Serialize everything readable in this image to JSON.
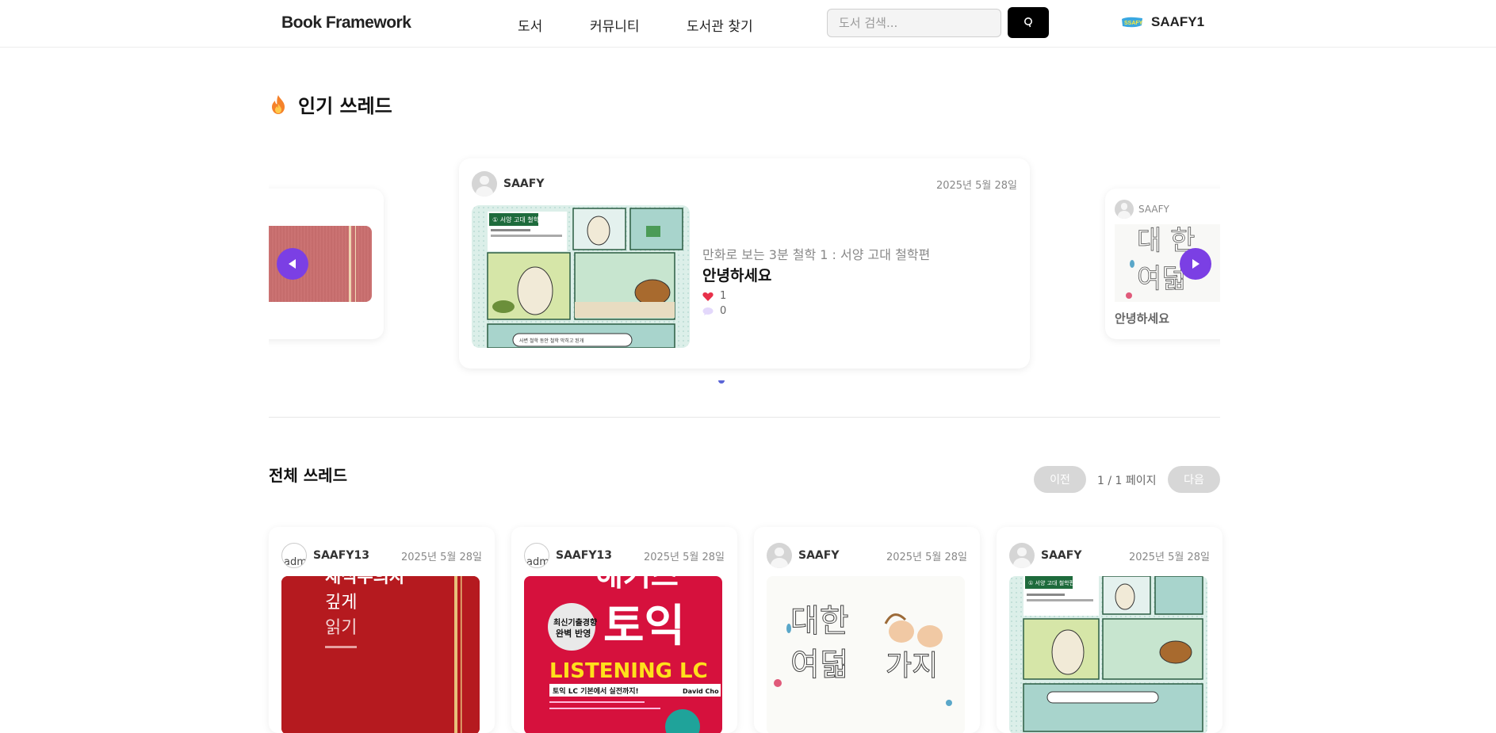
{
  "header": {
    "logo": "Book Framework",
    "nav": [
      "도서",
      "커뮤니티",
      "도서관 찾기"
    ],
    "search_placeholder": "도서 검색...",
    "user_name": "SAAFY1",
    "user_logo_icon": "ssafy-logo-icon"
  },
  "popular": {
    "title": "인기 쓰레드",
    "main_card": {
      "author": "SAAFY",
      "date": "2025년 5월 28일",
      "book": "만화로 보는 3분 철학 1 : 서양 고대 철학편",
      "cover_label": "① 서양 고대 철학편",
      "cover_caption": "사변 철학 동안 철학 막히고 된개",
      "title": "안녕하세요",
      "likes": "1",
      "comments": "0"
    },
    "right_card": {
      "author": "SAAFY",
      "title": "안녕하세요"
    }
  },
  "all": {
    "title": "전체 쓰레드",
    "prev": "이전",
    "page_info": "1 / 1 페이지",
    "next": "다음",
    "cards": [
      {
        "author": "SAAFY13",
        "date": "2025년 5월 28일",
        "avatar_alt": "adm",
        "cover_lines": [
          "채식주의자",
          "깊게",
          "읽기"
        ]
      },
      {
        "author": "SAAFY13",
        "date": "2025년 5월 28일",
        "avatar_alt": "adm",
        "cover_lines": [
          "해커스",
          "토익",
          "LISTENING LC",
          "토익 LC 기본에서 실전까지!",
          "최신기출경향",
          "완벽 반영",
          "David Cho"
        ]
      },
      {
        "author": "SAAFY",
        "date": "2025년 5월 28일",
        "avatar_alt": "",
        "cover_lines": [
          "대한",
          "여덟",
          "가지"
        ]
      },
      {
        "author": "SAAFY",
        "date": "2025년 5월 28일",
        "avatar_alt": "",
        "cover_lines": [
          "① 서양 고대 철학편"
        ]
      }
    ]
  },
  "colors": {
    "accent_purple": "#7b3fe4",
    "heart": "#e8304a",
    "search_button": "#000000"
  }
}
